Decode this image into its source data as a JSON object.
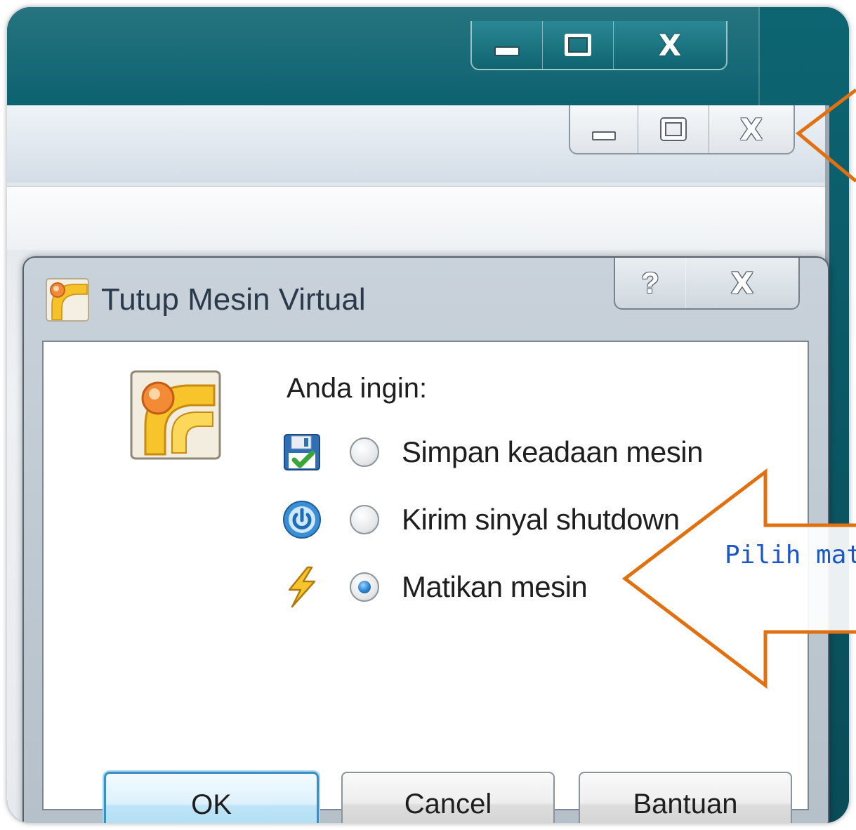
{
  "back_window": {
    "caption_buttons": {
      "minimize": "minimize",
      "maximize": "maximize",
      "close": "close"
    }
  },
  "middle_window": {
    "caption_buttons": {
      "minimize": "minimize",
      "maximize": "maximize",
      "close": "close"
    }
  },
  "dialog": {
    "title": "Tutup Mesin Virtual",
    "help_button": "?",
    "prompt": "Anda ingin:",
    "options": [
      {
        "label": "Simpan keadaan mesin",
        "icon": "floppy-save-icon",
        "selected": false
      },
      {
        "label": "Kirim sinyal shutdown",
        "icon": "power-icon",
        "selected": false
      },
      {
        "label": "Matikan mesin",
        "icon": "lightning-icon",
        "selected": true
      }
    ],
    "buttons": {
      "ok": "OK",
      "cancel": "Cancel",
      "help": "Bantuan"
    }
  },
  "annotation": {
    "text": "Pilih mat",
    "arrow_color": "#e07010"
  },
  "colors": {
    "accent": "#3c8fc2",
    "annotation_text": "#1a56c8",
    "annotation_arrow": "#e07010"
  }
}
